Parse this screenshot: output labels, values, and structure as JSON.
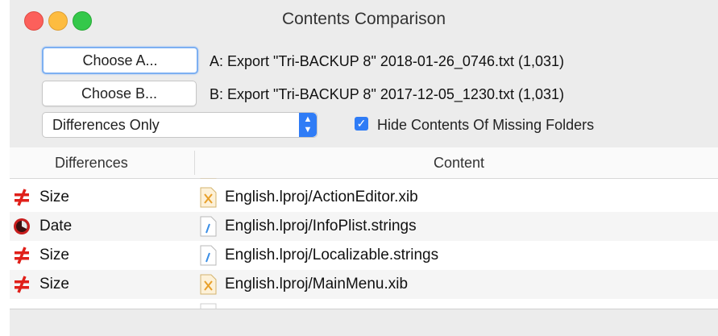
{
  "window": {
    "title": "Contents Comparison"
  },
  "buttons": {
    "choose_a": "Choose A...",
    "choose_b": "Choose B..."
  },
  "files": {
    "a": "A: Export \"Tri-BACKUP 8\" 2018-01-26_0746.txt (1,031)",
    "b": "B: Export \"Tri-BACKUP 8\" 2017-12-05_1230.txt (1,031)"
  },
  "filter": {
    "selected": "Differences Only"
  },
  "option": {
    "label": "Hide Contents Of Missing Folders",
    "checked": true
  },
  "table": {
    "headers": {
      "differences": "Differences",
      "content": "Content"
    },
    "rows": [
      {
        "diff": "Size",
        "diff_icon": "not-equal-icon",
        "content": "English.lproj/ActionEditor.xib",
        "file_icon": "xib-file-icon"
      },
      {
        "diff": "Date",
        "diff_icon": "clock-icon",
        "content": "English.lproj/InfoPlist.strings",
        "file_icon": "strings-file-icon"
      },
      {
        "diff": "Size",
        "diff_icon": "not-equal-icon",
        "content": "English.lproj/Localizable.strings",
        "file_icon": "strings-file-icon"
      },
      {
        "diff": "Size",
        "diff_icon": "not-equal-icon",
        "content": "English.lproj/MainMenu.xib",
        "file_icon": "xib-file-icon"
      }
    ]
  },
  "colors": {
    "accent": "#2f7cf6",
    "not_equal": "#e0201a",
    "clock": "#c81e1e"
  }
}
